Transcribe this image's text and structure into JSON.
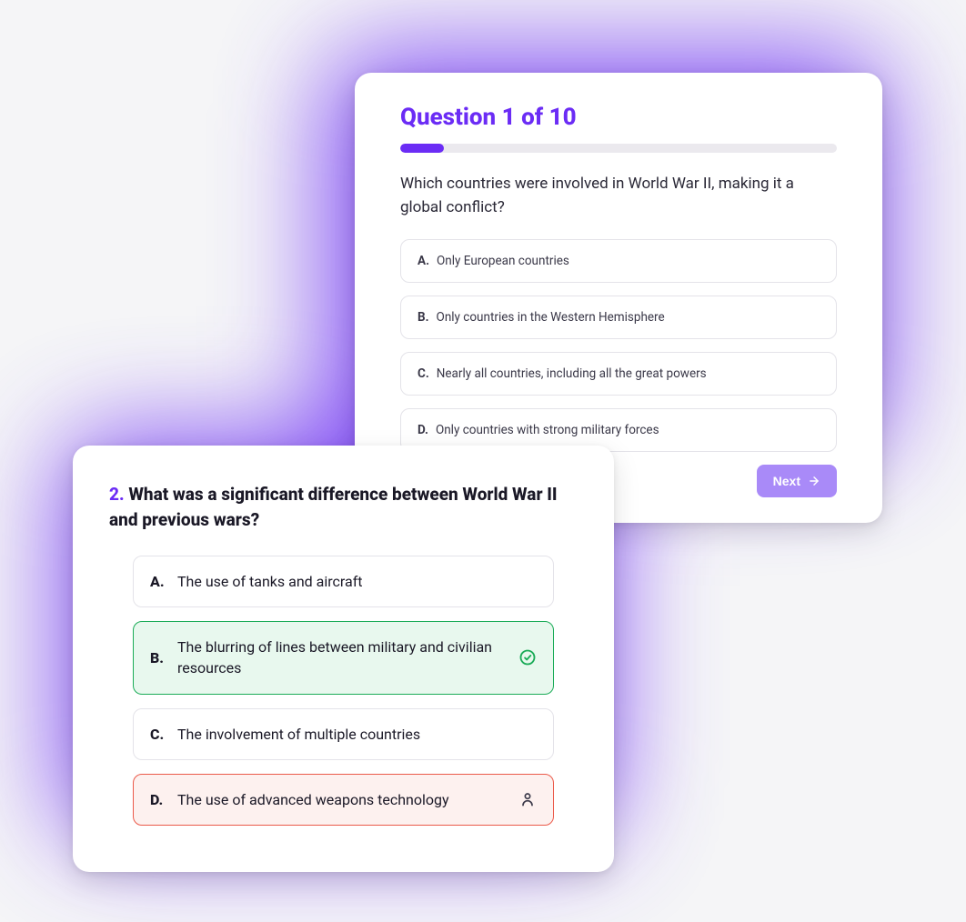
{
  "card1": {
    "title": "Question 1 of 10",
    "progress_percent": 10,
    "question": "Which countries were involved in World War II, making it a global conflict?",
    "options": [
      {
        "letter": "A.",
        "text": "Only European countries"
      },
      {
        "letter": "B.",
        "text": "Only countries in the Western Hemisphere"
      },
      {
        "letter": "C.",
        "text": "Nearly all countries, including all the great powers"
      },
      {
        "letter": "D.",
        "text": "Only countries with strong military forces"
      }
    ],
    "next_label": "Next"
  },
  "card2": {
    "number": "2.",
    "question": "What was a significant difference between World War II and previous wars?",
    "options": [
      {
        "letter": "A.",
        "text": "The use of tanks and aircraft",
        "state": "default"
      },
      {
        "letter": "B.",
        "text": "The blurring of lines between military and civilian resources",
        "state": "correct"
      },
      {
        "letter": "C.",
        "text": "The involvement of multiple countries",
        "state": "default"
      },
      {
        "letter": "D.",
        "text": "The use of advanced weapons technology",
        "state": "wrong"
      }
    ]
  },
  "colors": {
    "accent": "#6b2cf5",
    "correct": "#1aab57",
    "wrong": "#eb5a4a"
  }
}
